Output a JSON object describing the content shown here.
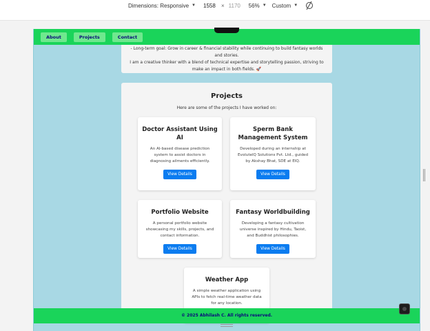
{
  "devtools": {
    "dimensions_label": "Dimensions: Responsive",
    "width": "1558",
    "height_placeholder": "1170",
    "times": "×",
    "zoom": "56%",
    "throttle": "Custom"
  },
  "nav": {
    "items": [
      "About",
      "Projects",
      "Contact"
    ]
  },
  "about": {
    "line1": "- Long-term goal: Grow in career & financial stability while continuing to build fantasy worlds and stories.",
    "line2": "I am a creative thinker with a blend of technical expertise and storytelling passion, striving to make an impact in both fields. 🚀"
  },
  "projects": {
    "title": "Projects",
    "subtitle": "Here are some of the projects I have worked on:",
    "items": [
      {
        "title": "Doctor Assistant Using AI",
        "desc": "An AI-based disease prediction system to assist doctors in diagnosing ailments efficiently.",
        "button": "View Details"
      },
      {
        "title": "Sperm Bank Management System",
        "desc": "Developed during an internship at EvolutelQ Solutions Pvt. Ltd., guided by Akshay Bhat, SDE at EIQ.",
        "button": "View Details"
      },
      {
        "title": "Portfolio Website",
        "desc": "A personal portfolio website showcasing my skills, projects, and contact information.",
        "button": "View Details"
      },
      {
        "title": "Fantasy Worldbuilding",
        "desc": "Developing a fantasy cultivation universe inspired by Hindu, Taoist, and Buddhist philosophies.",
        "button": "View Details"
      },
      {
        "title": "Weather App",
        "desc": "A simple weather application using APIs to fetch real-time weather data for any location.",
        "button": ""
      }
    ]
  },
  "footer": {
    "text": "© 2025 Abhilash C. All rights reserved."
  },
  "colors": {
    "nav_green": "#1ad45a",
    "page_bg": "#a8d8e4",
    "button_blue": "#0a7cf0",
    "nav_text": "#0b0b7a"
  }
}
